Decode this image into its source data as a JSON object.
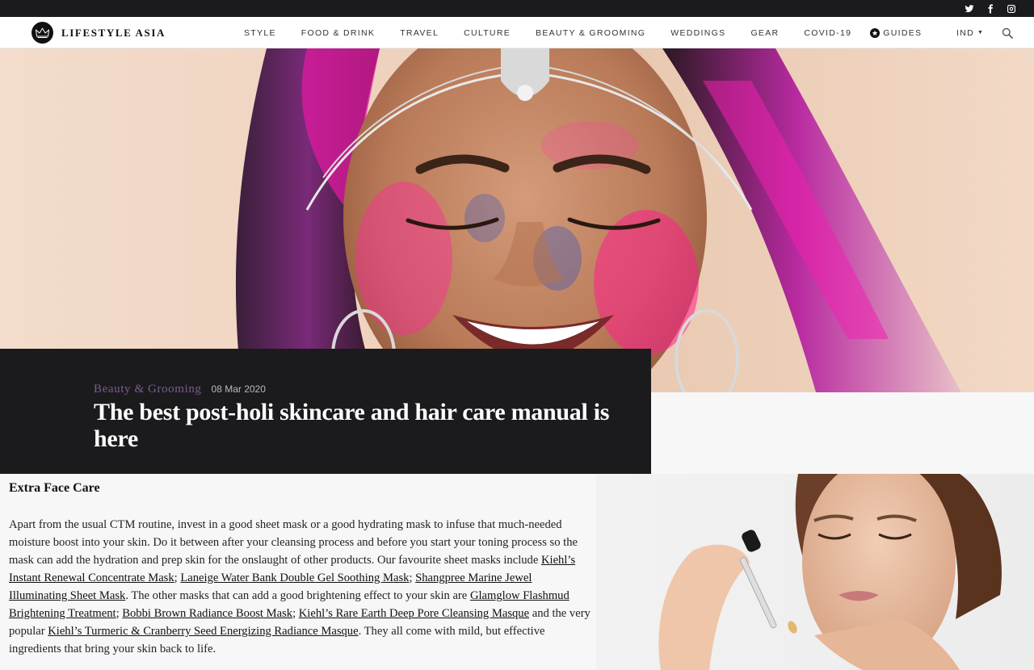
{
  "brand": {
    "name": "LIFESTYLE ASIA"
  },
  "social": [
    "twitter-icon",
    "facebook-icon",
    "instagram-icon"
  ],
  "nav": {
    "items": [
      "STYLE",
      "FOOD & DRINK",
      "TRAVEL",
      "CULTURE",
      "BEAUTY & GROOMING",
      "WEDDINGS",
      "GEAR",
      "COVID-19"
    ],
    "guides": "GUIDES",
    "region": "IND"
  },
  "article": {
    "category": "Beauty & Grooming",
    "date": "08 Mar 2020",
    "title": "The best post-holi skincare and hair care manual is here",
    "section_heading": "Extra Face Care",
    "paragraph": [
      {
        "text": "Apart from the usual CTM routine, invest in a good sheet mask or a good hydrating mask to infuse that much-needed moisture boost into your skin. Do it between after your cleansing process and before you start your toning process so the mask can add the hydration and prep skin for the onslaught of other products. Our favourite sheet masks include "
      },
      {
        "link": "Kiehl’s Instant Renewal Concentrate Mask"
      },
      {
        "text": "; "
      },
      {
        "link": "Laneige Water Bank Double Gel Soothing Mask"
      },
      {
        "text": "; "
      },
      {
        "link": "Shangpree Marine Jewel Illuminating Sheet Mask"
      },
      {
        "text": ". The other masks that can add a good brightening effect to your skin are "
      },
      {
        "link": "Glamglow Flashmud Brightening Treatment"
      },
      {
        "text": "; "
      },
      {
        "link": "Bobbi Brown Radiance Boost Mask"
      },
      {
        "text": "; "
      },
      {
        "link": "Kiehl’s Rare Earth Deep Pore Cleansing Masque"
      },
      {
        "text": " and the very popular "
      },
      {
        "link": "Kiehl’s Turmeric & Cranberry Seed Energizing Radiance Masque"
      },
      {
        "text": ". They all come with mild, but effective ingredients that bring your skin back to life."
      }
    ]
  },
  "colors": {
    "topbar": "#1b1b1d",
    "title_card": "#1b1b1d",
    "category": "#7e5a8e",
    "page_bg": "#f7f7f7"
  }
}
